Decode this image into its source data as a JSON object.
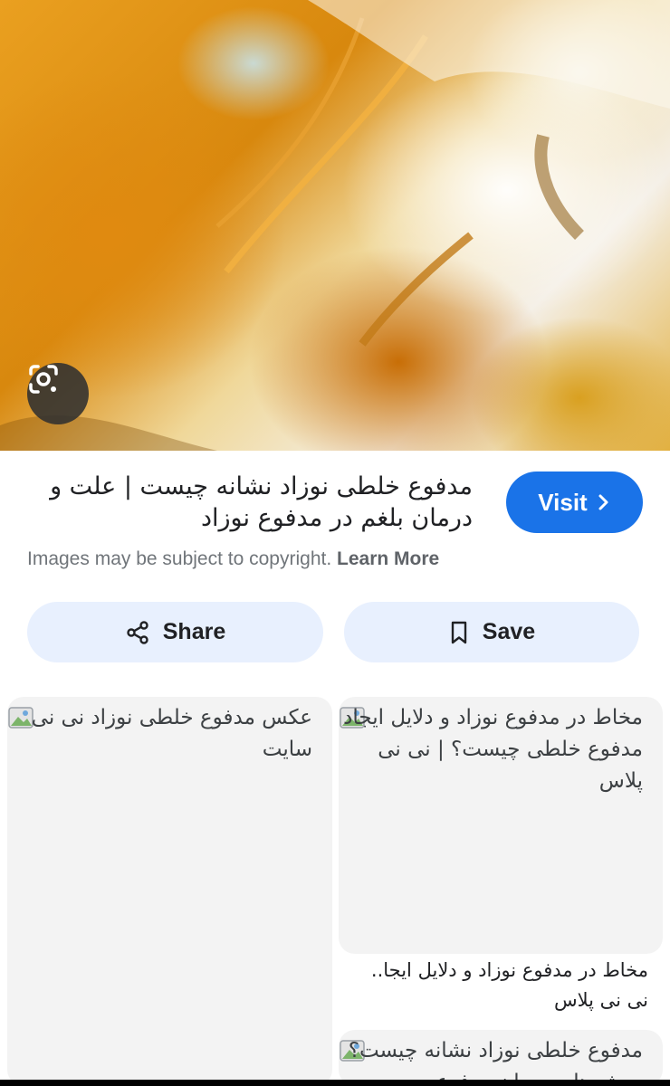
{
  "preview": {
    "lens_icon": "google-lens-icon"
  },
  "result": {
    "title": "مدفوع خلطی نوزاد نشانه چیست | علت و درمان بلغم در مدفوع نوزاد",
    "visit_label": "Visit",
    "copyright_text": "Images may be subject to copyright.",
    "learn_more_label": "Learn More"
  },
  "actions": {
    "share_label": "Share",
    "save_label": "Save"
  },
  "related": [
    {
      "alt_text": "عکس مدفوع خلطی نوزاد نی نی سایت"
    },
    {
      "alt_text": "مخاط در مدفوع نوزاد و دلایل ایجاد مدفوع خلطی چیست؟ | نی نی پلاس",
      "caption_title": "مخاط در مدفوع نوزاد و دلایل ایجا..",
      "caption_source": "نی نی پلاس"
    },
    {
      "alt_text": "مدفوع خلطی نوزاد نشانه چیست؟ روش های درمان مدفوع"
    }
  ],
  "colors": {
    "accent": "#1a73e8",
    "pill_bg": "#e8f0fe",
    "card_bg": "#f3f3f3"
  }
}
